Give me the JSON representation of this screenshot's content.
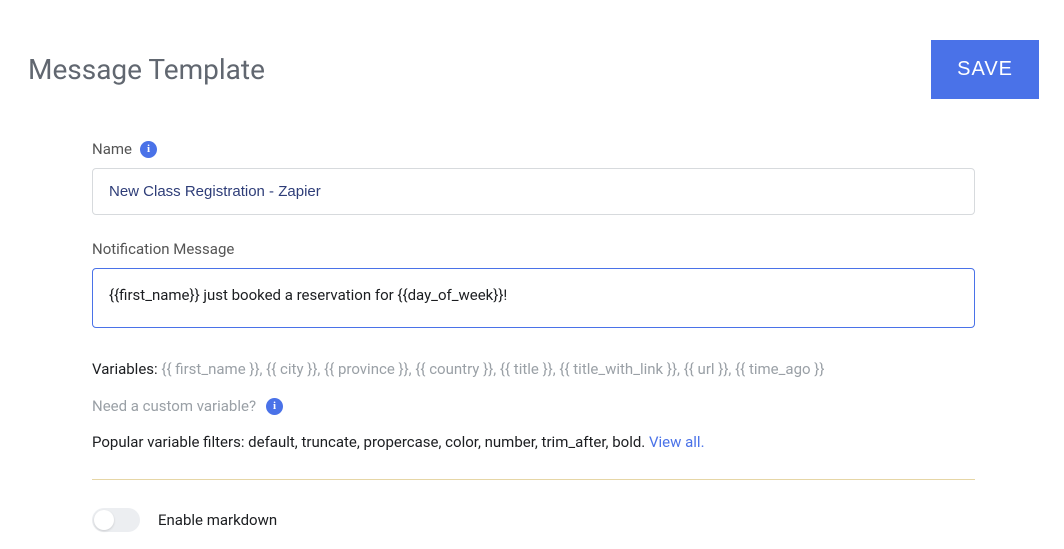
{
  "header": {
    "title": "Message Template",
    "save_label": "SAVE"
  },
  "name_field": {
    "label": "Name",
    "value": "New Class Registration - Zapier"
  },
  "notification_field": {
    "label": "Notification Message",
    "value": "{{first_name}} just booked a reservation for {{day_of_week}}!"
  },
  "variables": {
    "label": "Variables:",
    "tokens": "{{ first_name }}, {{ city }}, {{ province }}, {{ country }}, {{ title }}, {{ title_with_link }}, {{ url }}, {{ time_ago }}"
  },
  "custom_variable": {
    "text": "Need a custom variable?"
  },
  "filters": {
    "text": "Popular variable filters: default, truncate, propercase, color, number, trim_after, bold. ",
    "link_text": "View all."
  },
  "markdown_toggle": {
    "label": "Enable markdown",
    "enabled": false
  },
  "icons": {
    "info_glyph": "i"
  }
}
